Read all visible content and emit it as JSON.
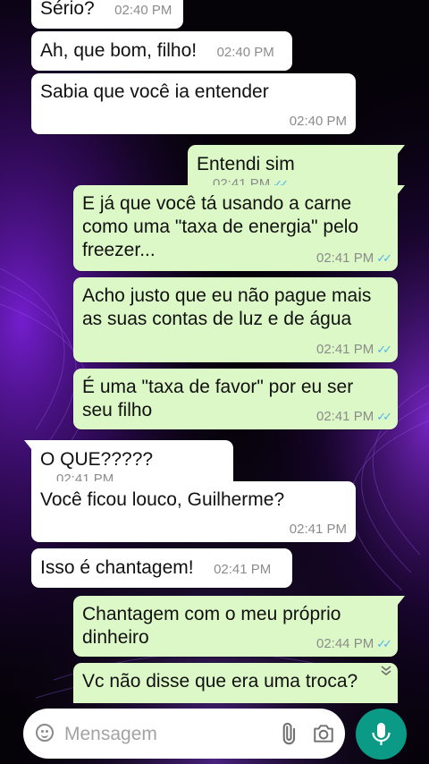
{
  "colors": {
    "incoming_bubble": "#ffffff",
    "outgoing_bubble": "#dcf8c6",
    "read_ticks": "#4fb6ec",
    "mic_button": "#0b9a86",
    "wallpaper_glow": "#6a1cc9"
  },
  "messages": [
    {
      "direction": "in",
      "text": "Sério?",
      "time": "02:40 PM"
    },
    {
      "direction": "in",
      "text": "Ah, que bom, filho!",
      "time": "02:40 PM"
    },
    {
      "direction": "in",
      "text": "Sabia que você ia entender",
      "time": "02:40 PM"
    },
    {
      "direction": "out",
      "text": "Entendi sim",
      "time": "02:41 PM",
      "status": "read"
    },
    {
      "direction": "out",
      "text": "E já que você tá usando a carne como uma \"taxa de energia\" pelo freezer...",
      "time": "02:41 PM",
      "status": "read"
    },
    {
      "direction": "out",
      "text": "Acho justo que eu não pague mais as suas contas de luz e de água",
      "time": "02:41 PM",
      "status": "read"
    },
    {
      "direction": "out",
      "text": "É uma \"taxa de favor\" por eu ser seu filho",
      "time": "02:41 PM",
      "status": "read"
    },
    {
      "direction": "in",
      "text": "O QUE?????",
      "time": "02:41 PM"
    },
    {
      "direction": "in",
      "text": "Você ficou louco, Guilherme?",
      "time": "02:41 PM"
    },
    {
      "direction": "in",
      "text": "Isso é chantagem!",
      "time": "02:41 PM"
    },
    {
      "direction": "out",
      "text": "Chantagem com o meu próprio dinheiro",
      "time": "02:44 PM",
      "status": "read"
    },
    {
      "direction": "out",
      "text": "Vc não disse que era uma troca?",
      "time": "",
      "status": ""
    }
  ],
  "composer": {
    "placeholder": "Mensagem",
    "emoji_icon": "smiley-icon",
    "attach_icon": "paperclip-icon",
    "camera_icon": "camera-icon",
    "send_icon": "microphone-icon"
  },
  "scroll_icon": "double-chevron-down-icon"
}
